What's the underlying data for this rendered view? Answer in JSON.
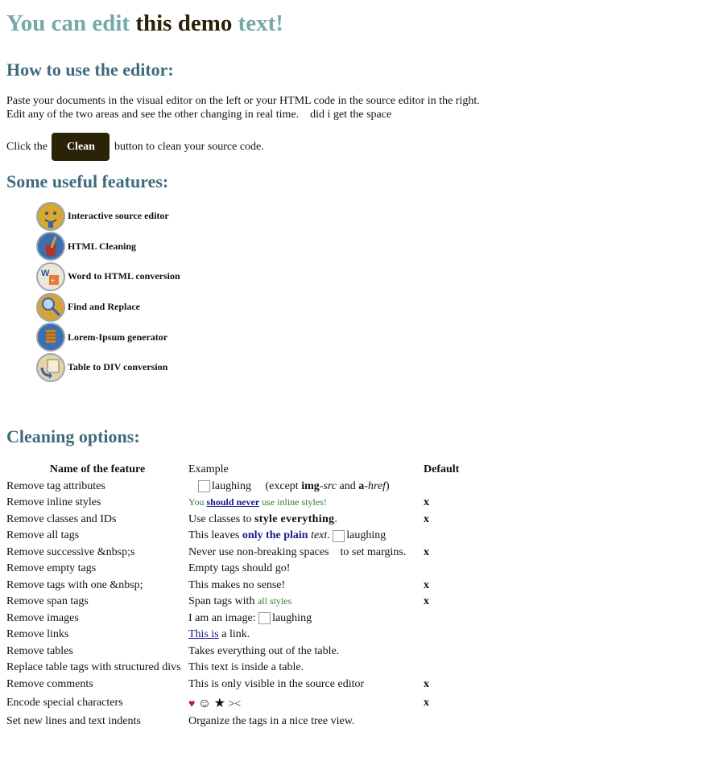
{
  "title": {
    "part1": "You can edit",
    "part2": "this demo",
    "part3": "text!"
  },
  "howto": {
    "heading": "How to use the editor:",
    "line1": "Paste your documents in the visual editor on the left or your HTML code in the source editor in the right.",
    "line2": "Edit any of the two areas and see the other changing in real time.    did i get the space",
    "click_pre": "Click the",
    "clean_label": "Clean",
    "click_post": "button to clean your source code."
  },
  "features": {
    "heading": "Some useful features:",
    "items": [
      {
        "label": "Interactive source editor",
        "icon": "smiley-face-icon"
      },
      {
        "label": "HTML Cleaning",
        "icon": "bucket-broom-icon"
      },
      {
        "label": "Word to HTML conversion",
        "icon": "word-doc-icon"
      },
      {
        "label": "Find and Replace",
        "icon": "magnifier-icon"
      },
      {
        "label": "Lorem-Ipsum generator",
        "icon": "grid-pattern-icon"
      },
      {
        "label": "Table to DIV conversion",
        "icon": "table-arrow-icon"
      }
    ]
  },
  "cleaning": {
    "heading": "Cleaning options:",
    "headers": {
      "name": "Name of the feature",
      "example": "Example",
      "default": "Default"
    },
    "rows": [
      {
        "name": "Remove tag attributes",
        "ex_alt": "laughing",
        "ex_a": "(except ",
        "ex_b": "img",
        "ex_c": "-",
        "ex_d": "src",
        "ex_e": " and ",
        "ex_f": "a",
        "ex_g": "-",
        "ex_h": "href",
        "ex_i": ")",
        "def": ""
      },
      {
        "name": "Remove inline styles",
        "ex_a": "You ",
        "ex_b": "should never",
        "ex_c": " use inline styles!",
        "def": "x"
      },
      {
        "name": "Remove classes and IDs",
        "ex_a": "Use classes to ",
        "ex_b": "style everything",
        "ex_c": ".",
        "def": "x"
      },
      {
        "name": "Remove all tags",
        "ex_a": "This leaves ",
        "ex_b": "only the plain",
        "ex_c": " text",
        "ex_d": ".",
        "ex_alt": "laughing",
        "def": ""
      },
      {
        "name": "Remove successive &nbsp;s",
        "ex_a": "Never use non-breaking spaces",
        "ex_b": "to set margins.",
        "def": "x"
      },
      {
        "name": "Remove empty tags",
        "ex_a": "Empty tags should go!",
        "def": ""
      },
      {
        "name": "Remove tags with one &nbsp;",
        "ex_a": "This makes no sense!",
        "def": "x"
      },
      {
        "name": "Remove span tags",
        "ex_a": "Span tags with ",
        "ex_b": "all styles",
        "def": "x"
      },
      {
        "name": "Remove images",
        "ex_a": "I am an image: ",
        "ex_alt": "laughing",
        "def": ""
      },
      {
        "name": "Remove links",
        "ex_a": "This is",
        "ex_b": " a link.",
        "def": ""
      },
      {
        "name": "Remove tables",
        "ex_a": "Takes everything out of the table.",
        "def": ""
      },
      {
        "name": "Replace table tags with structured divs",
        "ex_a": "This text is inside a table.",
        "def": ""
      },
      {
        "name": "Remove comments",
        "ex_a": "This is only visible in the source editor",
        "def": "x"
      },
      {
        "name": "Encode special characters",
        "ex_a": "♥",
        "ex_b": "☺",
        "ex_c": "★",
        "ex_d": "><",
        "def": "x"
      },
      {
        "name": "Set new lines and text indents",
        "ex_a": "Organize the tags in a nice tree view.",
        "def": ""
      }
    ]
  }
}
